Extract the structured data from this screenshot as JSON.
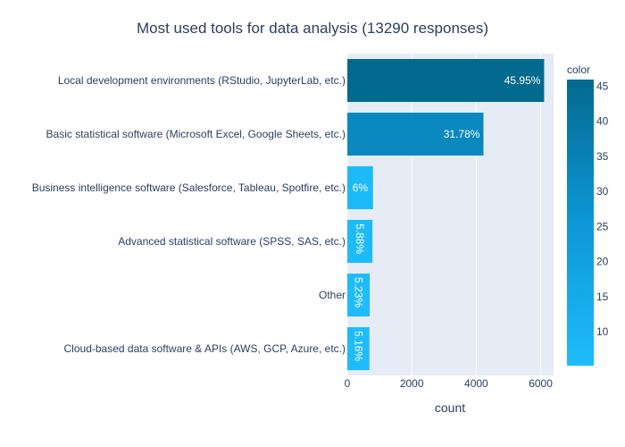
{
  "chart_data": {
    "type": "bar",
    "orientation": "horizontal",
    "title": "Most used tools for data analysis (13290 responses)",
    "xlabel": "count",
    "ylabel": "",
    "xlim": [
      0,
      6400
    ],
    "x_ticks": [
      0,
      2000,
      4000,
      6000
    ],
    "grid": true,
    "categories": [
      "Local development environments (RStudio, JupyterLab, etc.)",
      "Basic statistical software (Microsoft Excel, Google Sheets, etc.)",
      "Business intelligence software (Salesforce, Tableau, Spotfire, etc.)",
      "Advanced statistical software (SPSS, SAS, etc.)",
      "Other",
      "Cloud-based data software & APIs (AWS, GCP, Azure, etc.)"
    ],
    "values": [
      6107,
      4224,
      797,
      781,
      695,
      686
    ],
    "percent_labels": [
      "45.95%",
      "31.78%",
      "6%",
      "5.88%",
      "5.23%",
      "5.16%"
    ],
    "color_values": [
      45.95,
      31.78,
      6.0,
      5.88,
      5.23,
      5.16
    ],
    "colorbar": {
      "title": "color",
      "ticks": [
        10,
        15,
        20,
        25,
        30,
        35,
        40,
        45
      ],
      "range": [
        5.16,
        45.95
      ],
      "colors": [
        "#1ebcfb",
        "#0d97d6",
        "#036a8f"
      ]
    }
  }
}
